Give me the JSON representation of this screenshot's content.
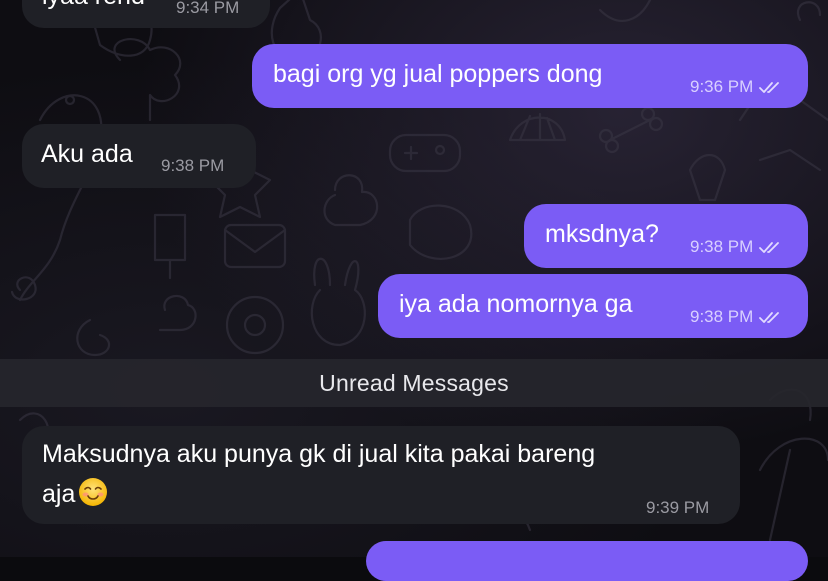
{
  "messages": [
    {
      "id": "m1",
      "direction": "incoming",
      "text": "iyaa rend",
      "time": "9:34 PM"
    },
    {
      "id": "m2",
      "direction": "outgoing",
      "text": "bagi org yg jual poppers dong",
      "time": "9:36 PM",
      "status": "read"
    },
    {
      "id": "m3",
      "direction": "incoming",
      "text": "Aku ada",
      "time": "9:38 PM"
    },
    {
      "id": "m4",
      "direction": "outgoing",
      "text": "mksdnya?",
      "time": "9:38 PM",
      "status": "read"
    },
    {
      "id": "m5",
      "direction": "outgoing",
      "text": "iya ada nomornya ga",
      "time": "9:38 PM",
      "status": "read"
    },
    {
      "id": "m6",
      "direction": "incoming",
      "text_line1": "Maksudnya aku punya gk di jual kita pakai bareng",
      "text_line2": "aja",
      "emoji": "smiling-face-icon",
      "time": "9:39 PM"
    }
  ],
  "unread_divider": {
    "label": "Unread Messages"
  },
  "colors": {
    "outgoing_bubble": "#7b5cf5",
    "incoming_bubble": "#1f2026",
    "background": "#0e0d12",
    "divider": "#26262c"
  },
  "icons": {
    "read_status": "double-check-icon"
  }
}
